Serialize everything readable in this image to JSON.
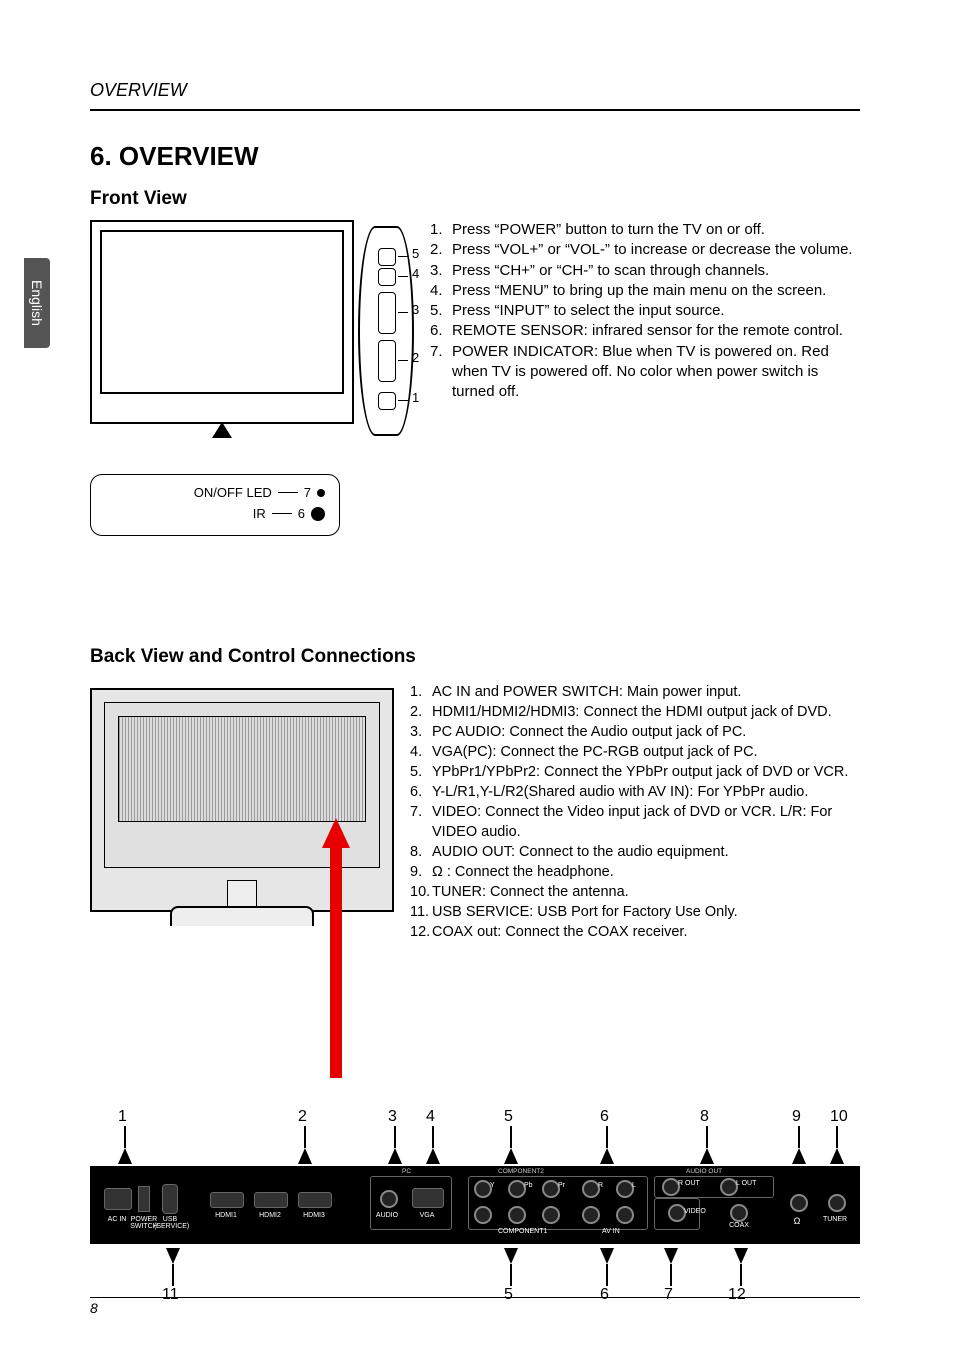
{
  "lang_tab": "English",
  "running_header": "OVERVIEW",
  "h1": "6. OVERVIEW",
  "front": {
    "h2": "Front View",
    "side_buttons": [
      "INPUT",
      "MENU",
      "CH",
      "VOL",
      "POWER"
    ],
    "callouts": [
      "5",
      "4",
      "3",
      "2",
      "1"
    ],
    "legend": {
      "led_label": "ON/OFF LED",
      "led_num": "7",
      "ir_label": "IR",
      "ir_num": "6"
    },
    "list": [
      "Press “POWER” button to turn the TV on or off.",
      "Press “VOL+” or “VOL-” to increase or decrease the volume.",
      "Press “CH+” or “CH-” to scan through channels.",
      "Press “MENU” to bring up the main menu on the screen.",
      "Press “INPUT” to select the input source.",
      "REMOTE SENSOR: infrared sensor for the remote control.",
      "POWER INDICATOR: Blue when TV is powered on. Red when TV is powered off. No color when power switch is turned off."
    ]
  },
  "back": {
    "h2": "Back View and Control Connections",
    "list": [
      "AC IN and POWER SWITCH: Main power input.",
      "HDMI1/HDMI2/HDMI3: Connect the HDMI output jack of DVD.",
      "PC AUDIO: Connect the Audio output jack of PC.",
      "VGA(PC): Connect the PC-RGB output jack of PC.",
      "YPbPr1/YPbPr2: Connect the YPbPr output jack of DVD or VCR.",
      "Y-L/R1,Y-L/R2(Shared audio with AV IN): For YPbPr audio.",
      "VIDEO: Connect the Video input jack of DVD or VCR. L/R: For VIDEO audio.",
      "AUDIO OUT: Connect to the audio equipment.",
      "Ω : Connect the headphone.",
      "TUNER: Connect the antenna.",
      "USB SERVICE: USB Port for Factory Use Only.",
      "COAX out: Connect the COAX receiver."
    ],
    "top_callouts": [
      "1",
      "2",
      "3",
      "4",
      "5",
      "6",
      "8",
      "9",
      "10"
    ],
    "bot_callouts": [
      "11",
      "5",
      "6",
      "7",
      "12"
    ],
    "panel": {
      "ac_in": "AC IN",
      "power_switch": "POWER\nSWITCH",
      "usb": "USB\n(SERVICE)",
      "hdmi1": "HDMI1",
      "hdmi2": "HDMI2",
      "hdmi3": "HDMI3",
      "pc": "PC",
      "audio": "AUDIO",
      "vga": "VGA",
      "component1": "COMPONENT1",
      "component2": "COMPONENT2",
      "y": "Y",
      "pb": "Pb",
      "pr": "Pr",
      "r": "R",
      "l": "L",
      "av_in": "AV IN",
      "video": "VIDEO",
      "audio_out": "AUDIO OUT",
      "r_out": "R OUT",
      "l_out": "L OUT",
      "coax": "COAX",
      "headphone": "Ω",
      "tuner": "TUNER"
    }
  },
  "page_number": "8"
}
